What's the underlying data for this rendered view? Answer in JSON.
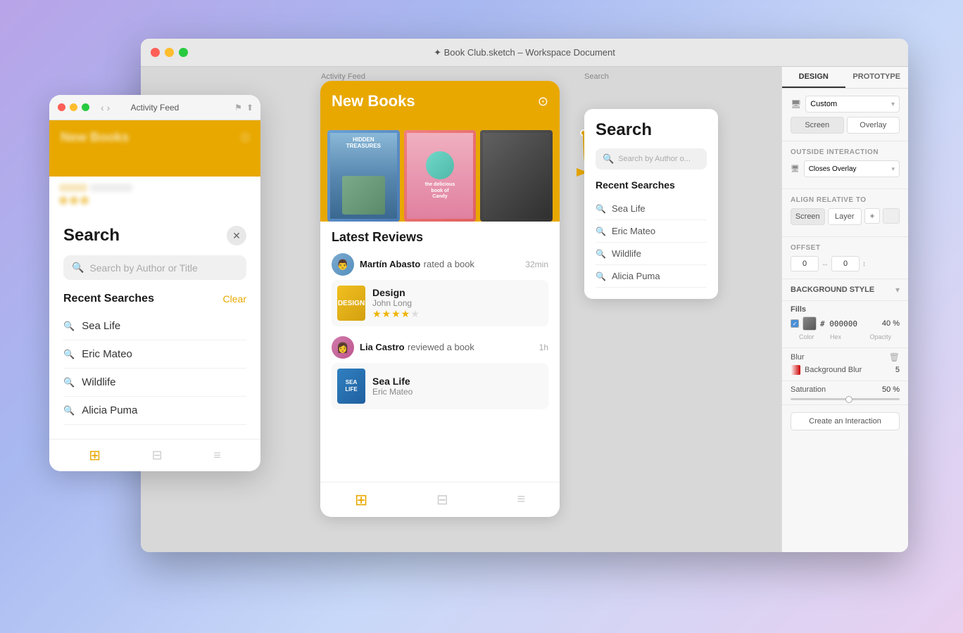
{
  "window": {
    "title": "✦ Book Club.sketch – Workspace Document",
    "tabs": {
      "design": "DESIGN",
      "prototype": "PROTOTYPE"
    }
  },
  "canvas": {
    "activityFeedLabel": "Activity Feed",
    "searchLabel": "Search"
  },
  "appScreen": {
    "header": {
      "title": "New Books"
    },
    "books": [
      {
        "title": "HIDDEN TREASURES",
        "color": "blue"
      },
      {
        "title": "the delicious book of Candy",
        "color": "teal"
      },
      {
        "title": "",
        "color": "dark"
      }
    ],
    "latestReviews": "Latest Reviews",
    "reviews": [
      {
        "name": "Martín Abasto",
        "action": "rated a book",
        "time": "32min",
        "bookTitle": "Design",
        "bookAuthor": "John Long",
        "stars": 4
      },
      {
        "name": "Lia Castro",
        "action": "reviewed a book",
        "time": "1h",
        "bookTitle": "Sea Life",
        "bookAuthor": "Eric Mateo",
        "stars": 0
      }
    ]
  },
  "searchOverlay": {
    "title": "Search",
    "placeholder": "Search by Author o...",
    "recentSearches": "Recent Searches",
    "items": [
      "Sea Life",
      "Eric Mateo",
      "Wildlife",
      "Alicia Puma"
    ]
  },
  "floatingWindow": {
    "title": "Activity Feed",
    "appTitle": "New Books",
    "searchModal": {
      "title": "Search",
      "placeholder": "Search by Author or Title",
      "recentSearches": "Recent Searches",
      "clearLabel": "Clear",
      "items": [
        "Sea Life",
        "Eric Mateo",
        "Wildlife",
        "Alicia Puma"
      ]
    }
  },
  "rightPanel": {
    "designTab": "DESIGN",
    "prototypeTab": "PROTOTYPE",
    "customLabel": "Custom",
    "screenBtn": "Screen",
    "overlayBtn": "Overlay",
    "outsideInteraction": "Outside Interaction",
    "closesOverlay": "Closes Overlay",
    "alignRelativeTo": "Align relative to",
    "screenAlignBtn": "Screen",
    "layerAlignBtn": "Layer",
    "offset": "Offset",
    "offsetX": "0",
    "offsetY": "0",
    "backgroundStyle": "BACKGROUND STYLE",
    "fills": "Fills",
    "fillHex": "000000",
    "fillOpacity": "40",
    "fillPercent": "%",
    "colorLabel": "Color",
    "hexLabel": "Hex",
    "opacityLabel": "Opacity",
    "blur": "Blur",
    "backgroundBlur": "Background Blur",
    "blurValue": "5",
    "saturation": "Saturation",
    "saturationValue": "50",
    "saturationPercent": "%",
    "createInteraction": "Create an Interaction"
  }
}
